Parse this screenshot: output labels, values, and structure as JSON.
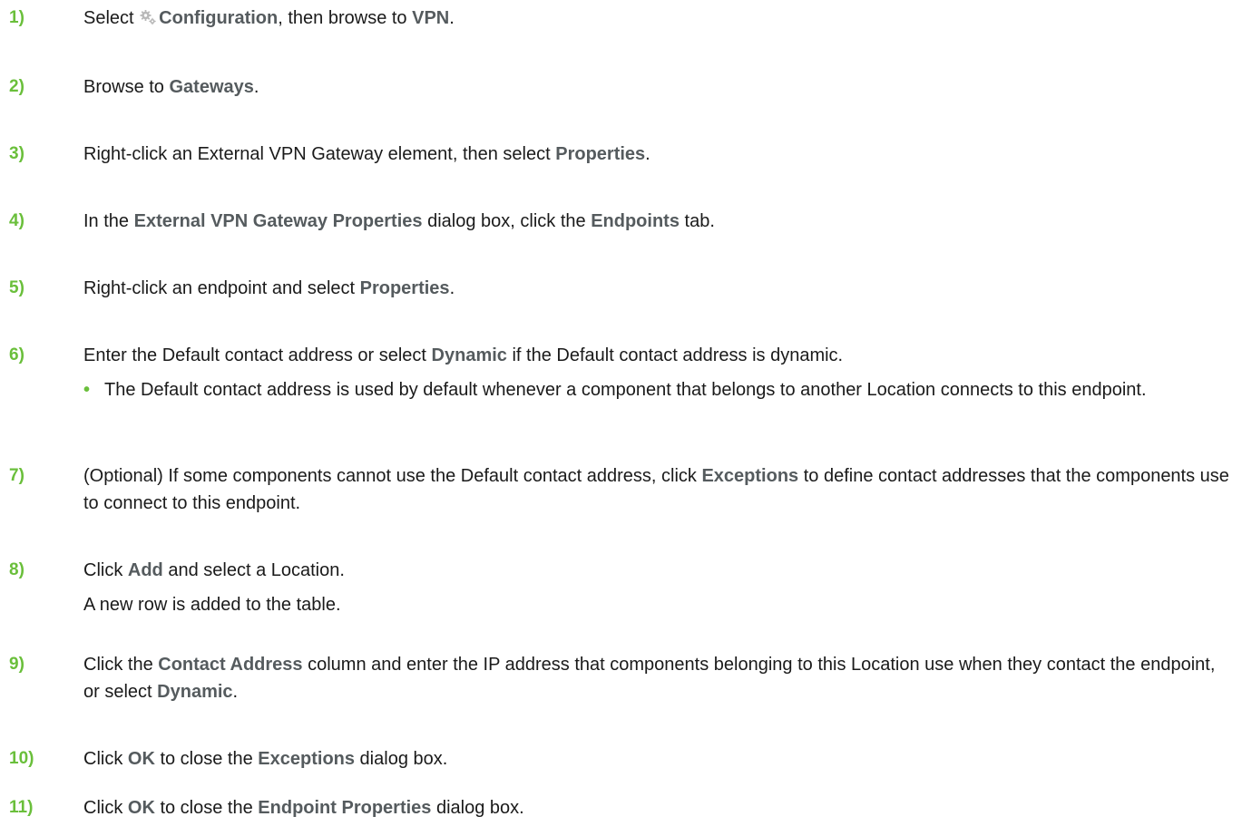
{
  "steps": [
    {
      "num": "1)",
      "t1": "Select ",
      "icon": "gear-icon",
      "b1": "Configuration",
      "t2": ", then browse to ",
      "b2": "VPN",
      "t3": "."
    },
    {
      "num": "2)",
      "t1": "Browse to ",
      "b1": "Gateways",
      "t2": "."
    },
    {
      "num": "3)",
      "t1": "Right-click an External VPN Gateway element, then select ",
      "b1": "Properties",
      "t2": "."
    },
    {
      "num": "4)",
      "t1": "In the ",
      "b1": "External VPN Gateway Properties",
      "t2": " dialog box, click the ",
      "b2": "Endpoints",
      "t3": " tab."
    },
    {
      "num": "5)",
      "t1": "Right-click an endpoint and select ",
      "b1": "Properties",
      "t2": "."
    },
    {
      "num": "6)",
      "t1": "Enter the Default contact address or select ",
      "b1": "Dynamic",
      "t2": " if the Default contact address is dynamic.",
      "bullet": "The Default contact address is used by default whenever a component that belongs to another Location connects to this endpoint."
    },
    {
      "num": "7)",
      "t1": "(Optional) If some components cannot use the Default contact address, click ",
      "b1": "Exceptions",
      "t2": " to define contact addresses that the components use to connect to this endpoint."
    },
    {
      "num": "8)",
      "t1": "Click ",
      "b1": "Add",
      "t2": " and select a Location.",
      "line2": "A new row is added to the table."
    },
    {
      "num": "9)",
      "t1": "Click the ",
      "b1": "Contact Address",
      "t2": " column and enter the IP address that components belonging to this Location use when they contact the endpoint, or select ",
      "b2": "Dynamic",
      "t3": "."
    },
    {
      "num": "10)",
      "t1": "Click ",
      "b1": "OK",
      "t2": " to close the ",
      "b2": "Exceptions",
      "t3": " dialog box."
    },
    {
      "num": "11)",
      "t1": "Click ",
      "b1": "OK",
      "t2": " to close the ",
      "b2": "Endpoint Properties",
      "t3": " dialog box."
    }
  ],
  "colors": {
    "step_number": "#6abf3b",
    "ui_term": "#555b5e",
    "body_text": "#1a1a1a"
  }
}
